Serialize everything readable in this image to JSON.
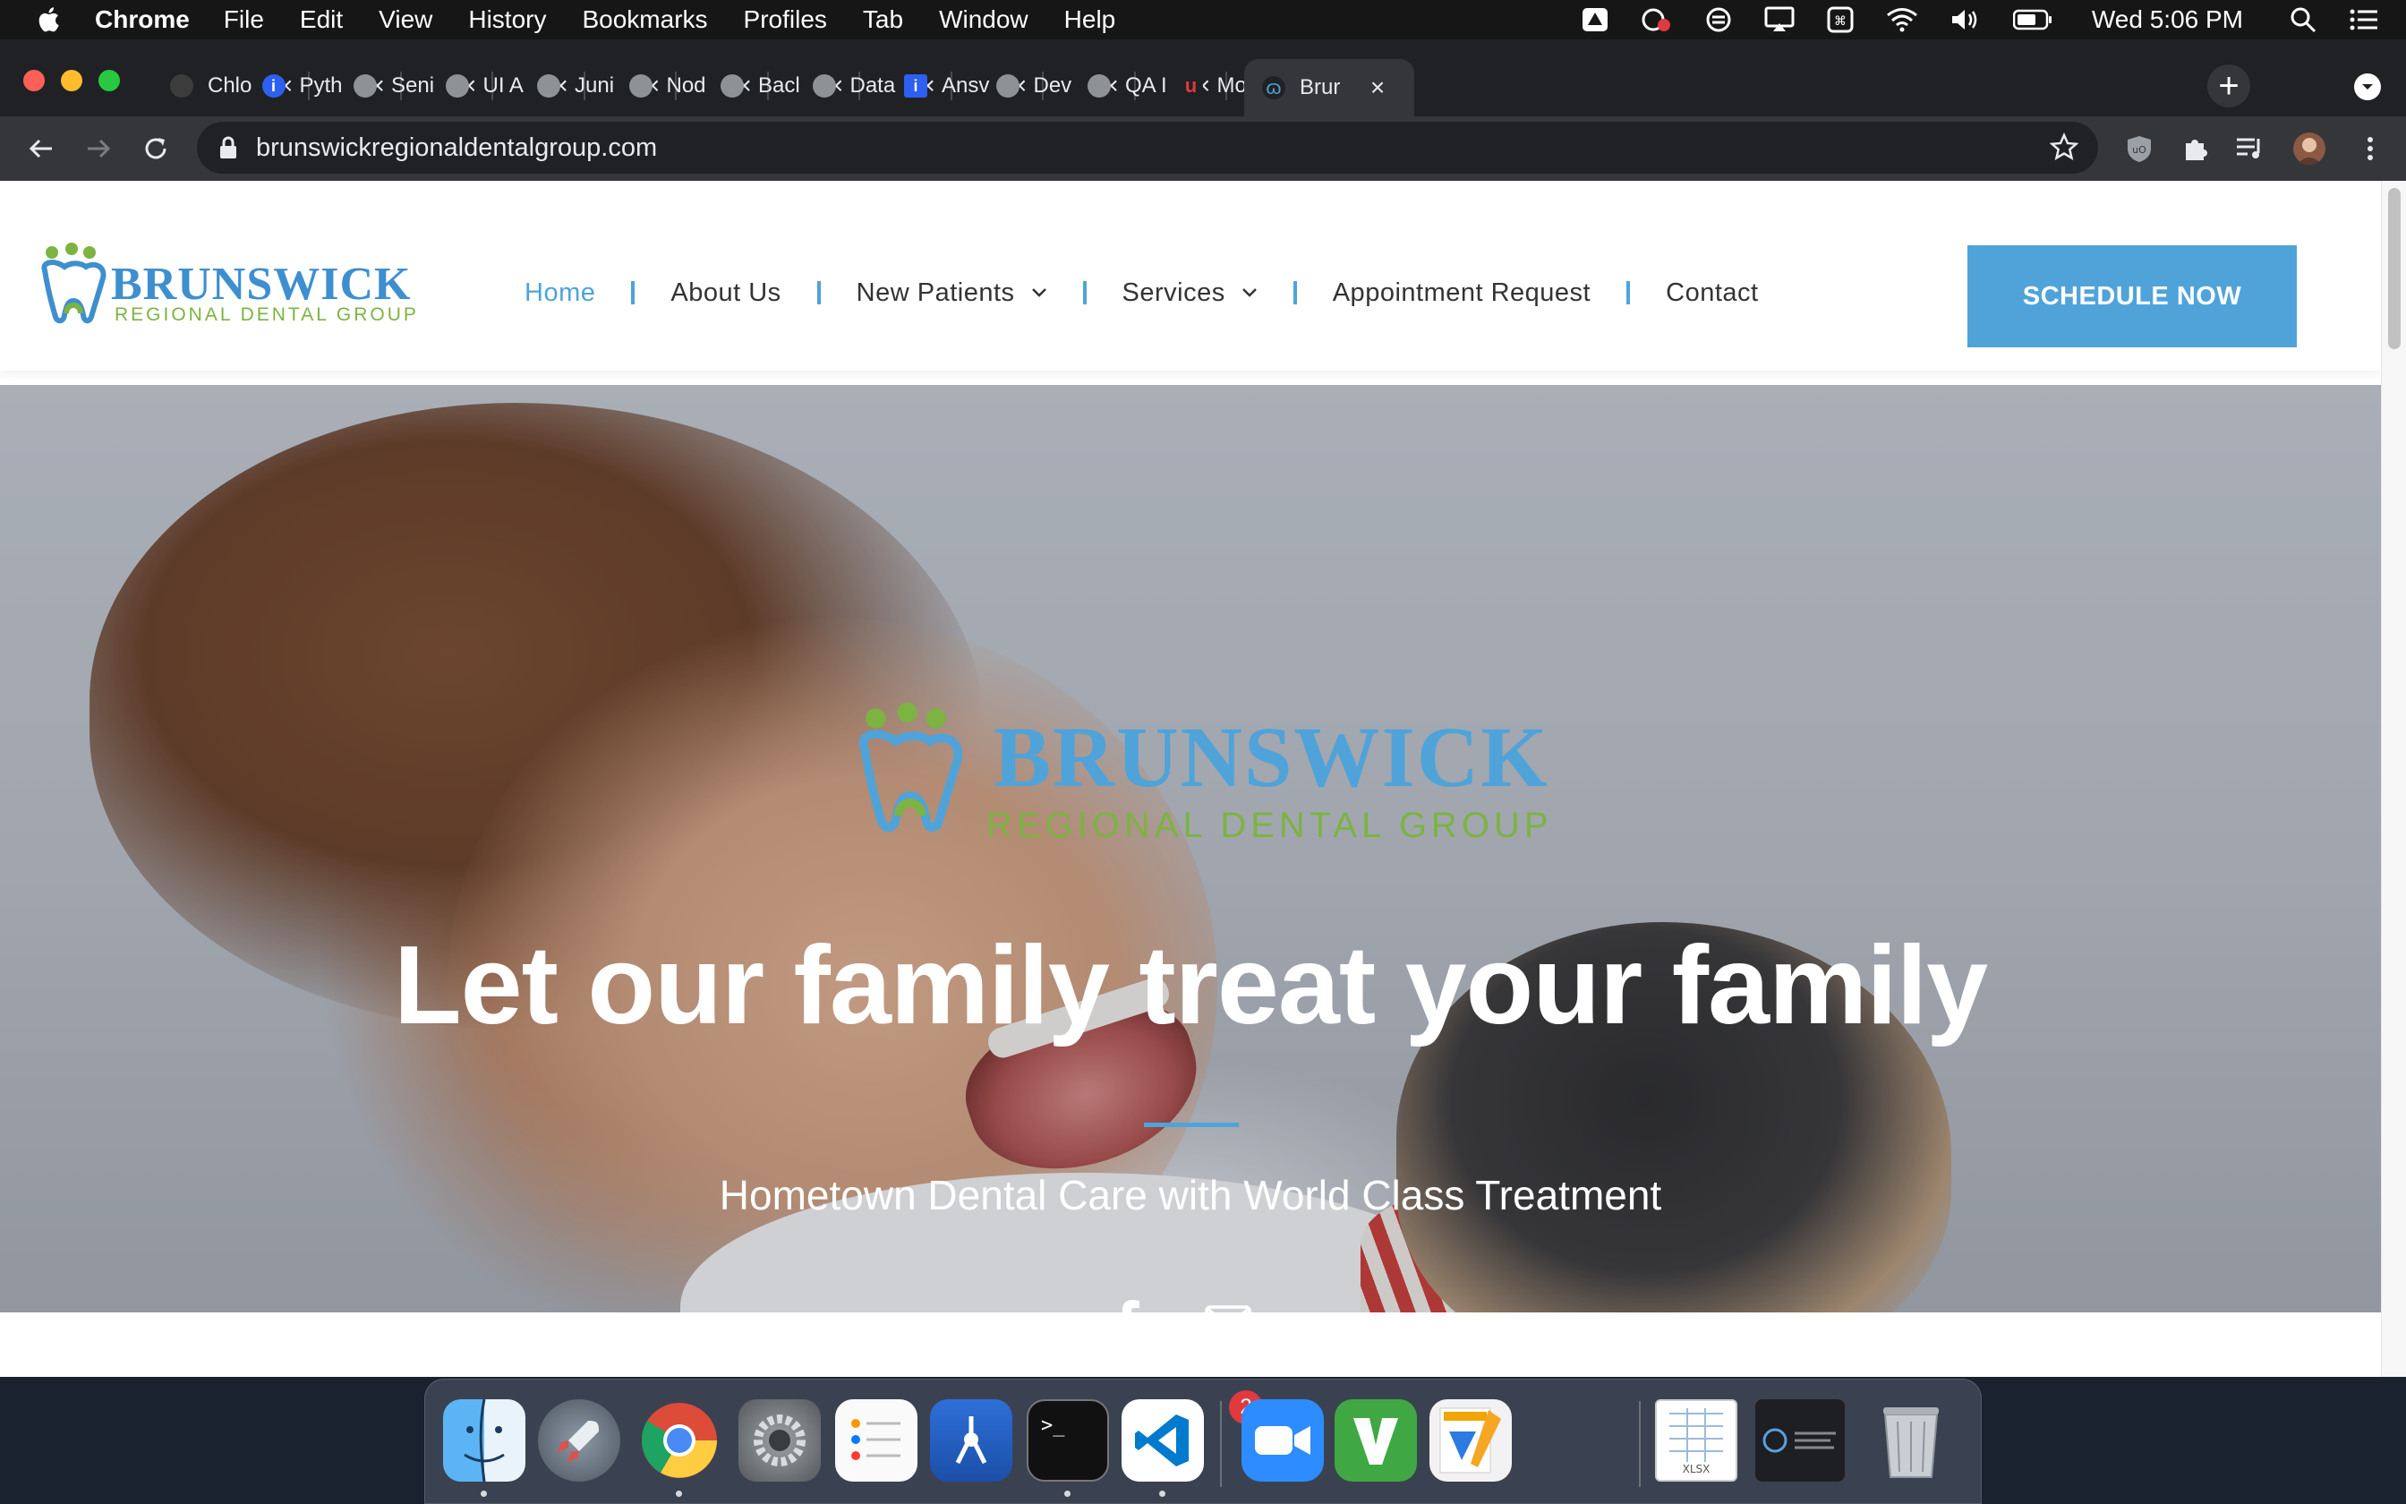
{
  "menubar": {
    "app": "Chrome",
    "items": [
      "File",
      "Edit",
      "View",
      "History",
      "Bookmarks",
      "Profiles",
      "Tab",
      "Window",
      "Help"
    ],
    "clock": "Wed 5:06 PM"
  },
  "tabs": [
    {
      "label": "Chlo",
      "icon": "dark-circle-icon"
    },
    {
      "label": "Pyth",
      "icon": "info-icon"
    },
    {
      "label": "Seni",
      "icon": "globe-icon"
    },
    {
      "label": "UI A",
      "icon": "globe-icon"
    },
    {
      "label": "Juni",
      "icon": "globe-icon"
    },
    {
      "label": "Nod",
      "icon": "globe-icon"
    },
    {
      "label": "Bacl",
      "icon": "globe-icon"
    },
    {
      "label": "Data",
      "icon": "globe-icon"
    },
    {
      "label": "Ansv",
      "icon": "info-square-icon"
    },
    {
      "label": "Dev",
      "icon": "globe-icon"
    },
    {
      "label": "QA I",
      "icon": "globe-icon"
    },
    {
      "label": "Mod",
      "icon": "u-logo-icon"
    },
    {
      "label": "Brur",
      "icon": "tooth-icon",
      "active": true
    }
  ],
  "address_bar": {
    "url": "brunswickregionaldentalgroup.com"
  },
  "site": {
    "logo": {
      "brand": "BRUNSWICK",
      "sub": "REGIONAL DENTAL GROUP"
    },
    "nav": {
      "home": "Home",
      "about": "About Us",
      "new_patients": "New Patients",
      "services": "Services",
      "appointment": "Appointment Request",
      "contact": "Contact"
    },
    "cta": "SCHEDULE NOW",
    "hero": {
      "logo_brand": "BRUNSWICK",
      "logo_sub": "REGIONAL DENTAL GROUP",
      "title": "Let our family treat your family",
      "subtitle": "Hometown Dental Care with World Class Treatment"
    }
  },
  "dock": {
    "apps": [
      "Finder",
      "Launchpad",
      "Google Chrome",
      "System Preferences",
      "Reminders",
      "Xcode Instruments",
      "Terminal",
      "Visual Studio Code",
      "Zoom",
      "Vim",
      "Pages",
      "Numbers",
      "Screenshot",
      "Trash"
    ],
    "badge_count": "2",
    "numbers_label": "XLSX"
  },
  "colors": {
    "accent_blue": "#4fa3d9",
    "logo_green": "#7cb342",
    "chrome_dark": "#202124"
  }
}
